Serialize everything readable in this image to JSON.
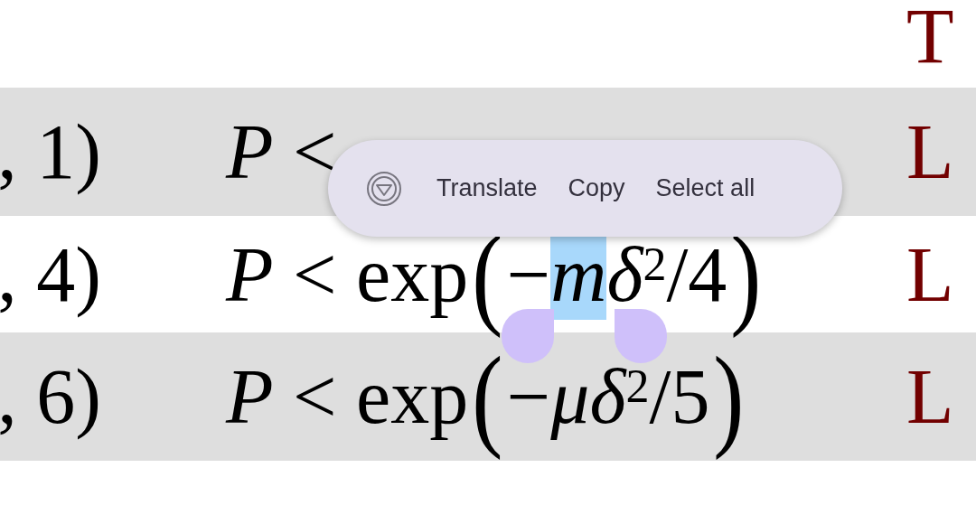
{
  "header": {
    "text": "T"
  },
  "rows": [
    {
      "shaded": true,
      "column_1": ", 1)",
      "formula": [
        {
          "kind": "italic",
          "text": "P",
          "selected": false
        },
        {
          "kind": "roman",
          "text": " <",
          "selected": false
        }
      ],
      "column_3": "L"
    },
    {
      "shaded": false,
      "column_1": ", 4)",
      "formula": [
        {
          "kind": "italic",
          "text": "P",
          "selected": false
        },
        {
          "kind": "roman",
          "text": " < exp",
          "selected": false
        },
        {
          "kind": "paren",
          "text": "(",
          "selected": false
        },
        {
          "kind": "roman",
          "text": "−",
          "selected": false
        },
        {
          "kind": "italic",
          "text": "m",
          "selected": true
        },
        {
          "kind": "italic",
          "text": "δ",
          "selected": false
        },
        {
          "kind": "sup",
          "text": "2",
          "selected": false
        },
        {
          "kind": "roman",
          "text": "/4",
          "selected": false
        },
        {
          "kind": "paren",
          "text": ")",
          "selected": false
        }
      ],
      "column_3": "L"
    },
    {
      "shaded": true,
      "column_1": ", 6)",
      "formula": [
        {
          "kind": "italic",
          "text": "P",
          "selected": false
        },
        {
          "kind": "roman",
          "text": " < exp",
          "selected": false
        },
        {
          "kind": "paren",
          "text": "(",
          "selected": false
        },
        {
          "kind": "roman",
          "text": "−",
          "selected": false
        },
        {
          "kind": "italic",
          "text": "μδ",
          "selected": false
        },
        {
          "kind": "sup",
          "text": "2",
          "selected": false
        },
        {
          "kind": "roman",
          "text": "/5",
          "selected": false
        },
        {
          "kind": "paren",
          "text": ")",
          "selected": false
        }
      ],
      "column_3": "L"
    }
  ],
  "selection_menu": {
    "items": [
      {
        "kind": "icon"
      },
      {
        "kind": "text",
        "label": "Translate"
      },
      {
        "kind": "text",
        "label": "Copy"
      },
      {
        "kind": "text",
        "label": "Select all"
      }
    ]
  }
}
